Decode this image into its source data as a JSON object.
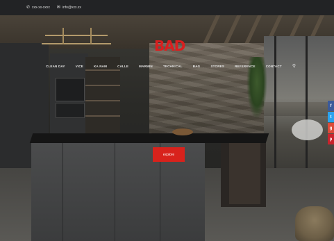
{
  "topbar": {
    "phone_icon": "phone-icon",
    "phone": "xxx-xx-xxxx",
    "email_icon": "envelope-icon",
    "email": "info@xxx.xx"
  },
  "brand": {
    "logo_text": "BAD",
    "logo_color": "#d91f1f"
  },
  "nav": {
    "items": [
      {
        "label": "CLEAN DAY"
      },
      {
        "label": "VICE"
      },
      {
        "label": "KA NAM"
      },
      {
        "label": "CALLE"
      },
      {
        "label": "MARMIN"
      },
      {
        "label": "TECHNICAL"
      },
      {
        "label": "BAG"
      },
      {
        "label": "STORES"
      },
      {
        "label": "REFERENCE"
      },
      {
        "label": "CONTACT"
      }
    ],
    "search_icon": "search-icon"
  },
  "hero": {
    "cta_label": "explore",
    "cta_color": "#d8221c"
  },
  "social": [
    {
      "icon": "facebook-icon",
      "glyph": "f",
      "color": "#3b5a9a"
    },
    {
      "icon": "twitter-icon",
      "glyph": "t",
      "color": "#2aa3ef"
    },
    {
      "icon": "google-plus-icon",
      "glyph": "g",
      "color": "#dc4a38"
    },
    {
      "icon": "pinterest-icon",
      "glyph": "p",
      "color": "#c8232c"
    }
  ]
}
